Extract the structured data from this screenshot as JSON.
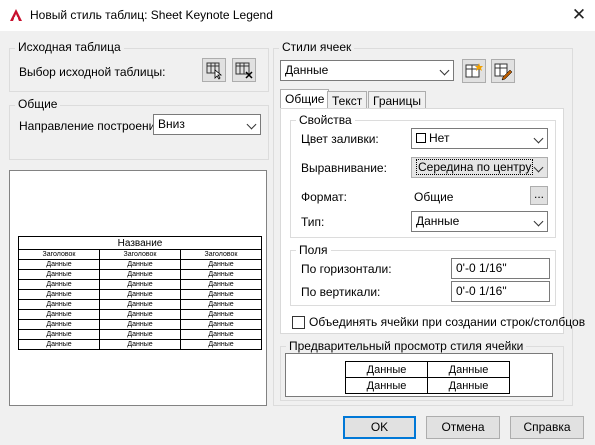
{
  "window": {
    "title": "Новый стиль таблиц: Sheet Keynote Legend",
    "close_glyph": "✕"
  },
  "source_table": {
    "group_label": "Исходная таблица",
    "select_label": "Выбор исходной таблицы:"
  },
  "general": {
    "group_label": "Общие",
    "direction_label": "Направление построения:",
    "direction_value": "Вниз"
  },
  "preview_table": {
    "title": "Название",
    "headers": [
      "Заголовок",
      "Заголовок",
      "Заголовок"
    ],
    "rows": [
      [
        "Данные",
        "Данные",
        "Данные"
      ],
      [
        "Данные",
        "Данные",
        "Данные"
      ],
      [
        "Данные",
        "Данные",
        "Данные"
      ],
      [
        "Данные",
        "Данные",
        "Данные"
      ],
      [
        "Данные",
        "Данные",
        "Данные"
      ],
      [
        "Данные",
        "Данные",
        "Данные"
      ],
      [
        "Данные",
        "Данные",
        "Данные"
      ],
      [
        "Данные",
        "Данные",
        "Данные"
      ],
      [
        "Данные",
        "Данные",
        "Данные"
      ]
    ]
  },
  "cell_styles": {
    "group_label": "Стили ячеек",
    "current_style": "Данные",
    "tabs": [
      "Общие",
      "Текст",
      "Границы"
    ]
  },
  "properties": {
    "group_label": "Свойства",
    "fill_label": "Цвет заливки:",
    "fill_value": "Нет",
    "align_label": "Выравнивание:",
    "align_value": "Середина по центру",
    "format_label": "Формат:",
    "format_value": "Общие",
    "format_button": "...",
    "type_label": "Тип:",
    "type_value": "Данные"
  },
  "margins": {
    "group_label": "Поля",
    "horizontal_label": "По горизонтали:",
    "horizontal_value": "0'-0 1/16\"",
    "vertical_label": "По вертикали:",
    "vertical_value": "0'-0 1/16\""
  },
  "merge_checkbox_label": "Объединять ячейки при создании строк/столбцов",
  "cell_preview": {
    "group_label": "Предварительный просмотр стиля ячейки",
    "cells": [
      [
        "Данные",
        "Данные"
      ],
      [
        "Данные",
        "Данные"
      ]
    ]
  },
  "buttons": {
    "ok": "OK",
    "cancel": "Отмена",
    "help": "Справка"
  },
  "colors": {
    "accent": "#0078d7",
    "app_icon": "#c8102e"
  }
}
